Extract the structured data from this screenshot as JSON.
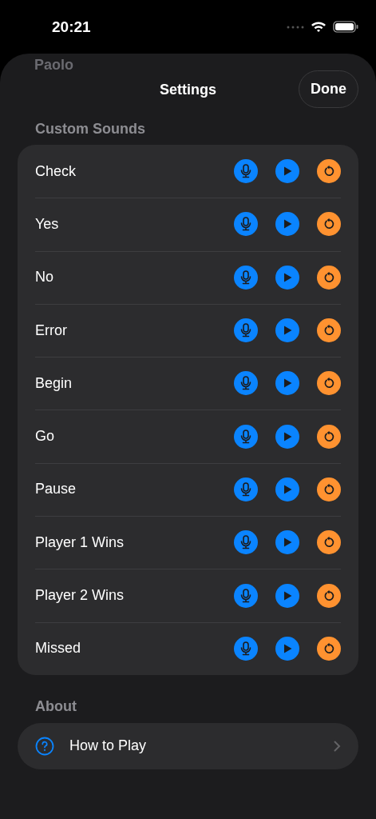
{
  "status_bar": {
    "time": "20:21"
  },
  "background_title": "Paolo",
  "header": {
    "title": "Settings",
    "done_button": "Done"
  },
  "sections": [
    {
      "title": "Custom Sounds",
      "kind": "sounds",
      "rows": [
        {
          "label": "Check"
        },
        {
          "label": "Yes"
        },
        {
          "label": "No"
        },
        {
          "label": "Error"
        },
        {
          "label": "Begin"
        },
        {
          "label": "Go"
        },
        {
          "label": "Pause"
        },
        {
          "label": "Player 1 Wins"
        },
        {
          "label": "Player 2 Wins"
        },
        {
          "label": "Missed"
        }
      ]
    },
    {
      "title": "About",
      "kind": "links",
      "rows": [
        {
          "label": "How to Play"
        }
      ]
    }
  ]
}
